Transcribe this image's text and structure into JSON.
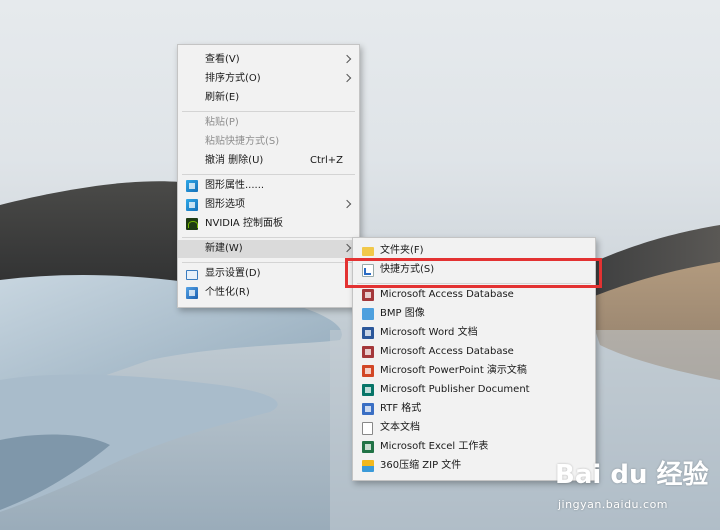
{
  "main_menu": {
    "items": [
      {
        "label": "查看(V)"
      },
      {
        "label": "排序方式(O)"
      },
      {
        "label": "刷新(E)"
      },
      {
        "label": "粘贴(P)"
      },
      {
        "label": "粘贴快捷方式(S)"
      },
      {
        "label": "撤消 删除(U)",
        "shortcut": "Ctrl+Z"
      },
      {
        "label": "图形属性......",
        "icon": "graphics-icon"
      },
      {
        "label": "图形选项",
        "icon": "graphics-options-icon"
      },
      {
        "label": "NVIDIA 控制面板",
        "icon": "nvidia-icon"
      },
      {
        "label": "新建(W)"
      },
      {
        "label": "显示设置(D)",
        "icon": "display-icon"
      },
      {
        "label": "个性化(R)",
        "icon": "personalize-icon"
      }
    ]
  },
  "sub_menu": {
    "items": [
      {
        "label": "文件夹(F)",
        "icon": "folder-icon"
      },
      {
        "label": "快捷方式(S)",
        "icon": "shortcut-icon"
      },
      {
        "label": "Microsoft Access Database",
        "icon": "access-icon"
      },
      {
        "label": "BMP 图像",
        "icon": "bmp-icon"
      },
      {
        "label": "Microsoft Word 文档",
        "icon": "word-icon"
      },
      {
        "label": "Microsoft Access Database",
        "icon": "access-icon"
      },
      {
        "label": "Microsoft PowerPoint 演示文稿",
        "icon": "powerpoint-icon"
      },
      {
        "label": "Microsoft Publisher Document",
        "icon": "publisher-icon"
      },
      {
        "label": "RTF 格式",
        "icon": "rtf-icon"
      },
      {
        "label": "文本文档",
        "icon": "text-document-icon"
      },
      {
        "label": "Microsoft Excel 工作表",
        "icon": "excel-icon"
      },
      {
        "label": "360压缩 ZIP 文件",
        "icon": "zip-icon"
      }
    ]
  },
  "colors": {
    "menu_bg": "#f2f2f2",
    "highlight_box": "#e33232",
    "disabled_text": "#8e8e8e"
  },
  "watermark": {
    "brand": "Bai du 经验",
    "url": "jingyan.baidu.com"
  }
}
